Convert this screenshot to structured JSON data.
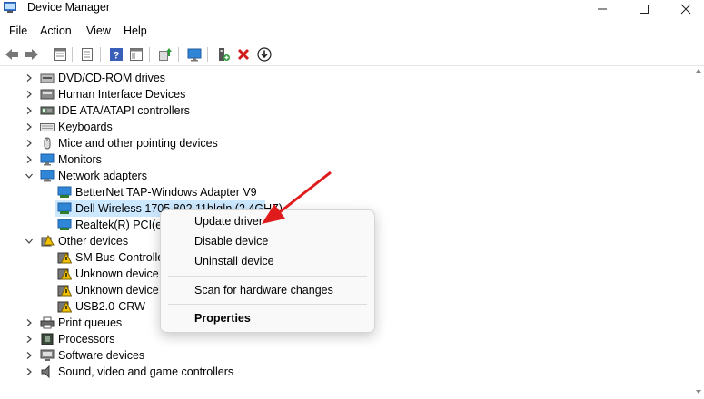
{
  "window": {
    "title": "Device Manager"
  },
  "menu": [
    "File",
    "Action",
    "View",
    "Help"
  ],
  "toolbar": {
    "icons": [
      "back-icon",
      "forward-icon",
      "properties-view-icon",
      "details-icon",
      "help-icon",
      "show-panel-icon",
      "update-driver-icon",
      "scan-hardware-icon",
      "monitor-icon",
      "add-driver-icon",
      "uninstall-icon",
      "download-icon"
    ]
  },
  "tree": {
    "items": [
      {
        "label": "DVD/CD-ROM drives",
        "icon": "dvd-drive-icon",
        "expanded": false
      },
      {
        "label": "Human Interface Devices",
        "icon": "hid-icon",
        "expanded": false
      },
      {
        "label": "IDE ATA/ATAPI controllers",
        "icon": "ide-controller-icon",
        "expanded": false
      },
      {
        "label": "Keyboards",
        "icon": "keyboard-icon",
        "expanded": false
      },
      {
        "label": "Mice and other pointing devices",
        "icon": "mouse-icon",
        "expanded": false
      },
      {
        "label": "Monitors",
        "icon": "monitor-icon",
        "expanded": false
      },
      {
        "label": "Network adapters",
        "icon": "network-adapter-icon",
        "expanded": true
      },
      {
        "label": "BetterNet TAP-Windows Adapter V9",
        "icon": "network-card-icon",
        "child": true
      },
      {
        "label": "Dell Wireless 1705 802.11b|g|n (2.4GHZ)",
        "icon": "network-card-icon",
        "child": true,
        "selected": true
      },
      {
        "label": "Realtek(R) PCI(e)",
        "icon": "network-card-icon",
        "child": true
      },
      {
        "label": "Other devices",
        "icon": "other-devices-icon",
        "expanded": true
      },
      {
        "label": "SM Bus Controller",
        "icon": "unknown-device-warning-icon",
        "child": true
      },
      {
        "label": "Unknown device",
        "icon": "unknown-device-warning-icon",
        "child": true
      },
      {
        "label": "Unknown device",
        "icon": "unknown-device-warning-icon",
        "child": true
      },
      {
        "label": "USB2.0-CRW",
        "icon": "unknown-device-warning-icon",
        "child": true
      },
      {
        "label": "Print queues",
        "icon": "printer-icon",
        "expanded": false
      },
      {
        "label": "Processors",
        "icon": "processor-icon",
        "expanded": false
      },
      {
        "label": "Software devices",
        "icon": "software-device-icon",
        "expanded": false
      },
      {
        "label": "Sound, video and game controllers",
        "icon": "sound-icon",
        "expanded": false
      }
    ]
  },
  "context_menu": {
    "update": "Update driver",
    "disable": "Disable device",
    "uninstall": "Uninstall device",
    "scan": "Scan for hardware changes",
    "properties": "Properties"
  },
  "annotation": {
    "arrow_color": "#e01b1b"
  },
  "colors": {
    "selection": "#cce8ff",
    "network": "#1e90d6",
    "warning": "#f2c200"
  }
}
